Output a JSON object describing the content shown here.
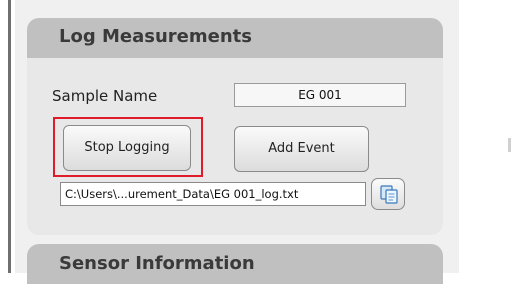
{
  "log_section": {
    "title": "Log Measurements",
    "sample_name_label": "Sample Name",
    "sample_name_value": "EG 001",
    "stop_logging_label": "Stop Logging",
    "add_event_label": "Add Event",
    "log_path_value": "C:\\Users\\...urement_Data\\EG 001_log.txt",
    "copy_icon": "copy-to-clipboard-icon"
  },
  "sensor_section": {
    "title": "Sensor Information"
  },
  "colors": {
    "highlight": "#e01c2a",
    "header": "#c0c0c0",
    "panel": "#e8e8e8"
  }
}
